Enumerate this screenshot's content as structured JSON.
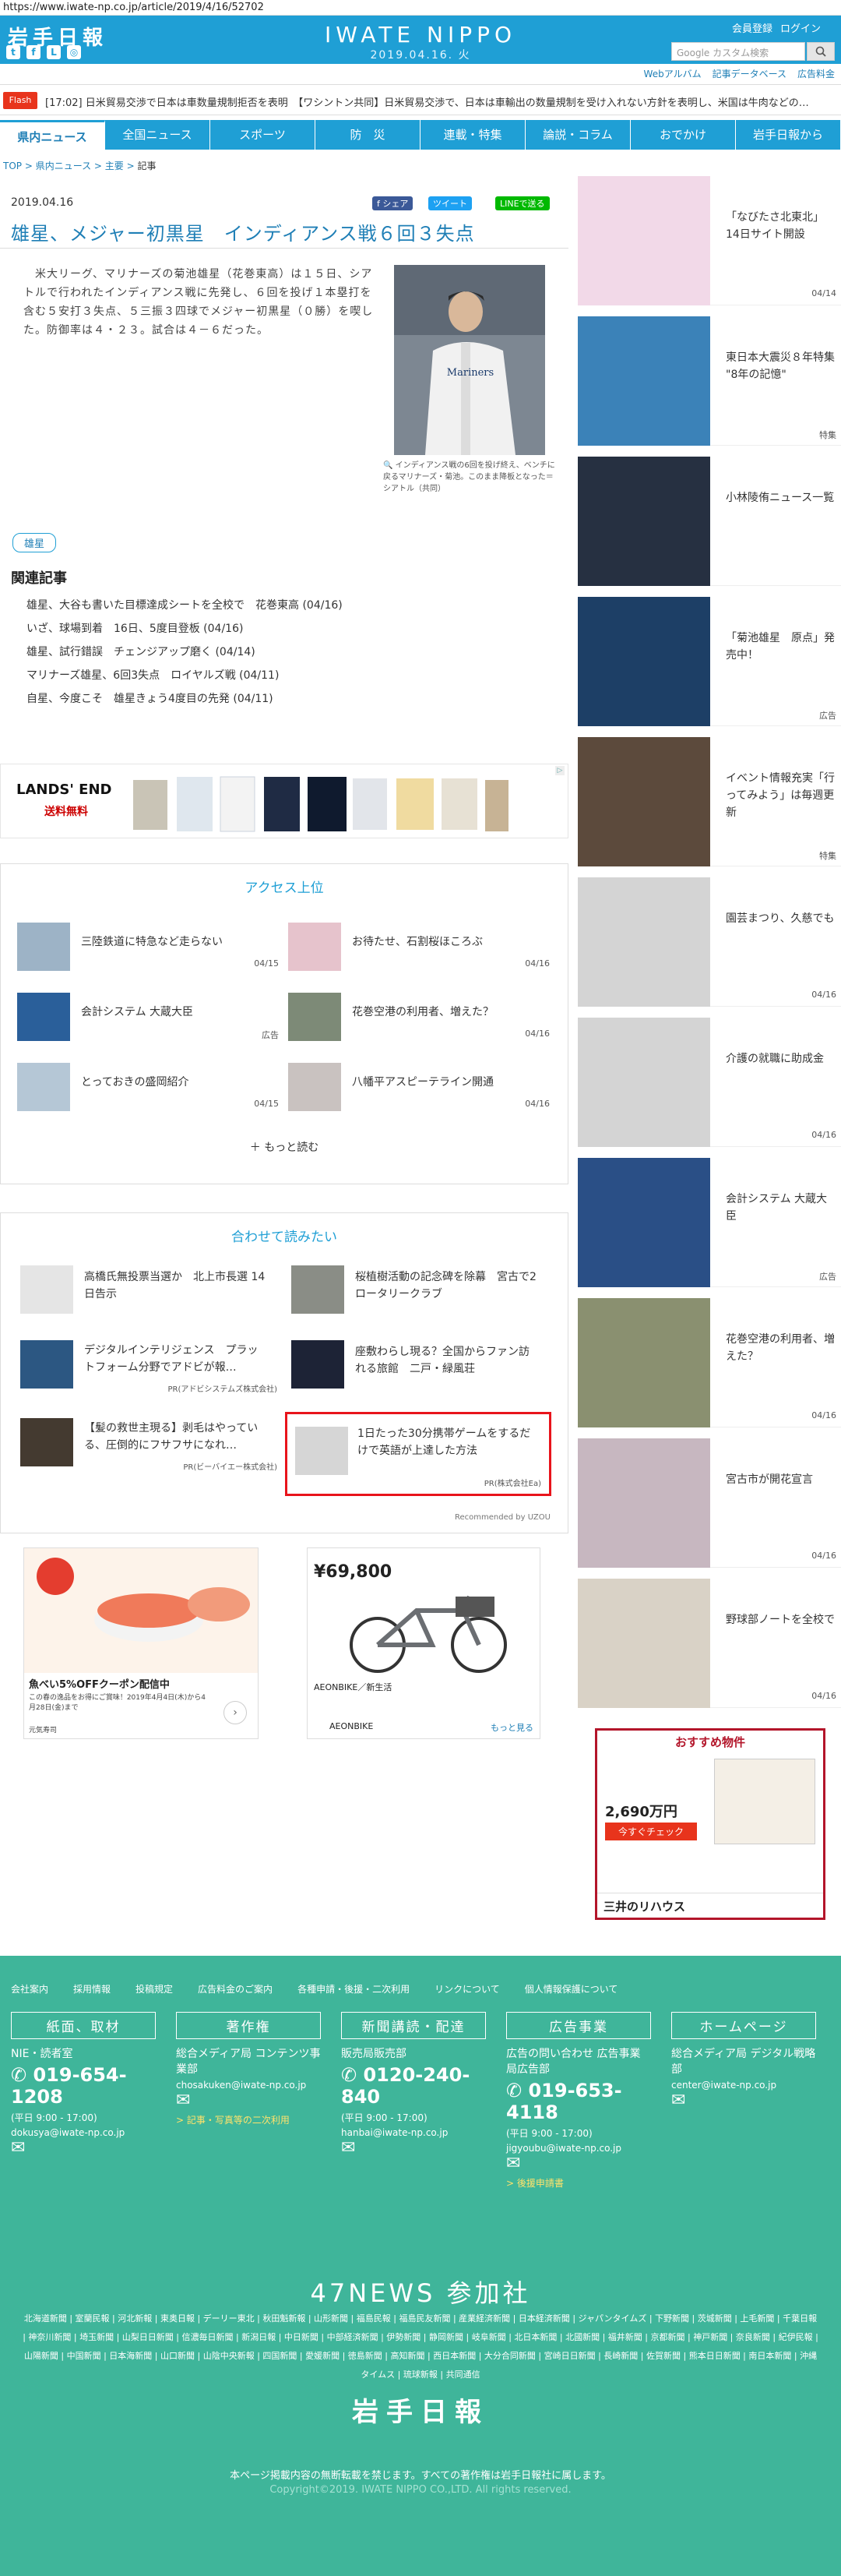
{
  "url": "https://www.iwate-np.co.jp/article/2019/4/16/52702",
  "header": {
    "logo": "岩手日報",
    "masthead": "IWATE NIPPO",
    "date": "2019.04.16. 火",
    "links": [
      "会員登録",
      "ログイン"
    ],
    "search_placeholder": "Google カスタム検索",
    "sublinks": [
      "Webアルバム",
      "記事データベース",
      "広告料金"
    ]
  },
  "flash": {
    "label": "Flash",
    "text": "[17:02] 日米貿易交渉で日本は車数量規制拒否を表明　【ワシントン共同】日米貿易交渉で、日本は車輸出の数量規制を受け入れない方針を表明し、米国は牛肉などの…"
  },
  "nav": [
    "県内ニュース",
    "全国ニュース",
    "スポーツ",
    "防　災",
    "連載・特集",
    "論説・コラム",
    "おでかけ",
    "岩手日報から"
  ],
  "breadcrumbs": [
    "TOP",
    "県内ニュース",
    "主要",
    "記事"
  ],
  "article": {
    "date": "2019.04.16",
    "share": [
      "f シェア",
      "ツイート",
      "LINEで送る"
    ],
    "title": "雄星、メジャー初黒星　インディアンス戦６回３失点",
    "body": "　米大リーグ、マリナーズの菊池雄星（花巻東高）は１５日、シアトルで行われたインディアンス戦に先発し、６回を投げ１本塁打を含む５安打３失点、５三振３四球でメジャー初黒星（０勝）を喫した。防御率は４・２３。試合は４－６だった。",
    "caption": "インディアンス戦の6回を投げ終え、ベンチに戻るマリナーズ・菊池。このまま降板となった＝シアトル（共同）",
    "tag": "雄星",
    "related_heading": "関連記事",
    "related": [
      "雄星、大谷も書いた目標達成シートを全校で　花巻東高 (04/16)",
      "いざ、球場到着　16日、5度目登板 (04/16)",
      "雄星、試行錯誤　チェンジアップ磨く (04/14)",
      "マリナーズ雄星、6回3失点　ロイヤルズ戦 (04/11)",
      "自星、今度こそ　雄星きょう4度目の先発 (04/11)"
    ]
  },
  "ad_top": {
    "brand": "LANDS' END",
    "sub": "送料無料"
  },
  "ranking": {
    "heading": "アクセス上位",
    "items": [
      {
        "title": "三陸鉄道に特急など走らない",
        "date": "04/15"
      },
      {
        "title": "お待たせ、石割桜ほころぶ",
        "date": "04/16"
      },
      {
        "title": "会計システム 大蔵大臣",
        "date": "広告"
      },
      {
        "title": "花巻空港の利用者、増えた？",
        "date": "04/16"
      },
      {
        "title": "とっておきの盛岡紹介",
        "date": "04/15"
      },
      {
        "title": "八幡平アスピーテライン開通",
        "date": "04/16"
      }
    ],
    "more": "もっと読む"
  },
  "recommend": {
    "heading": "合わせて読みたい",
    "items": [
      {
        "title": "高橋氏無投票当選か　北上市長選 14日告示",
        "src": ""
      },
      {
        "title": "桜植樹活動の記念碑を除幕　宮古で2ロータリークラブ",
        "src": ""
      },
      {
        "title": "デジタルインテリジェンス　プラットフォーム分野でアドビが報…",
        "src": "PR(アドビシステムズ株式会社)"
      },
      {
        "title": "座敷わらし現る？全国からファン訪れる旅館　二戸・緑風荘",
        "src": ""
      },
      {
        "title": "【髪の救世主現る】剥毛はやっている、圧倒的にフサフサになれ…",
        "src": "PR(ビーバイエー株式会社)"
      },
      {
        "title": "1日たった30分携帯ゲームをするだけで英語が上達した方法",
        "src": "PR(株式会社Ea)"
      }
    ],
    "powered": "Recommended by UZOU"
  },
  "ads_bottom": [
    {
      "title": "魚べい5%OFFクーポン配信中",
      "text": "この春の逸品をお得にご賞味！2019年4月4日(木)から4月28日(金)まで",
      "brand": "元気寿司"
    },
    {
      "title": "¥69,800",
      "text": "AEONBIKE／新生活",
      "brand": "AEONBIKE",
      "more": "もっと見る"
    }
  ],
  "sidebar": [
    {
      "title": "「なびたさ北東北」14日サイト開設",
      "date": "04/14"
    },
    {
      "title": "東日本大震災８年特集 \"8年の記憶\"",
      "date": "特集"
    },
    {
      "title": "小林陵侑ニュース一覧",
      "date": ""
    },
    {
      "title": "「菊池雄星　原点」発売中！",
      "date": "広告"
    },
    {
      "title": "イベント情報充実「行ってみよう」は毎週更新",
      "date": "特集"
    },
    {
      "title": "園芸まつり、久慈でも",
      "date": "04/16"
    },
    {
      "title": "介護の就職に助成金",
      "date": "04/16"
    },
    {
      "title": "会計システム 大蔵大臣",
      "date": "広告"
    },
    {
      "title": "花巻空港の利用者、増えた？",
      "date": "04/16"
    },
    {
      "title": "宮古市が開花宣言",
      "date": "04/16"
    },
    {
      "title": "野球部ノートを全校で",
      "date": "04/16"
    }
  ],
  "side_ad": {
    "head": "おすすめ物件",
    "price": "2,690万円",
    "btn": "今すぐチェック",
    "brand": "三井のリハウス"
  },
  "footer": {
    "links": [
      "会社案内",
      "採用情報",
      "投稿規定",
      "広告料金のご案内",
      "各種申請・後援・二次利用",
      "リンクについて",
      "個人情報保護について"
    ],
    "cols": [
      {
        "head": "紙面、取材",
        "sub": "NIE・読者室",
        "phone": "019-654-1208",
        "hours": "(平日 9:00 - 17:00)",
        "mail": "dokusya@iwate-np.co.jp"
      },
      {
        "head": "著作権",
        "sub": "総合メディア局 コンテンツ事業部",
        "phone": "",
        "hours": "",
        "mail": "chosakuken@iwate-np.co.jp",
        "link": "> 記事・写真等の二次利用"
      },
      {
        "head": "新聞講読・配達",
        "sub": "販売局販売部",
        "phone": "0120-240-840",
        "hours": "(平日 9:00 - 17:00)",
        "mail": "hanbai@iwate-np.co.jp"
      },
      {
        "head": "広告事業",
        "sub": "広告の問い合わせ 広告事業局広告部",
        "phone": "019-653-4118",
        "hours": "(平日 9:00 - 17:00)",
        "mail": "jigyoubu@iwate-np.co.jp",
        "link": "> 後援申請書"
      },
      {
        "head": "ホームページ",
        "sub": "総合メディア局 デジタル戦略部",
        "phone": "",
        "hours": "",
        "mail": "center@iwate-np.co.jp"
      }
    ],
    "news47": "47NEWS 参加社",
    "papers": "北海道新聞 | 室蘭民報 | 河北新報 | 東奥日報 | デーリー東北 | 秋田魁新報 | 山形新聞 | 福島民報 | 福島民友新聞 | 産業経済新聞 | 日本経済新聞 | ジャパンタイムズ | 下野新聞 | 茨城新聞 | 上毛新聞 | 千葉日報 | 神奈川新聞 | 埼玉新聞 | 山梨日日新聞 | 信濃毎日新聞 | 新潟日報 | 中日新聞 | 中部経済新聞 | 伊勢新聞 | 静岡新聞 | 岐阜新聞 | 北日本新聞 | 北國新聞 | 福井新聞 | 京都新聞 | 神戸新聞 | 奈良新聞 | 紀伊民報 | 山陽新聞 | 中国新聞 | 日本海新聞 | 山口新聞 | 山陰中央新報 | 四国新聞 | 愛媛新聞 | 徳島新聞 | 高知新聞 | 西日本新聞 | 大分合同新聞 | 宮崎日日新聞 | 長崎新聞 | 佐賀新聞 | 熊本日日新聞 | 南日本新聞 | 沖縄タイムス | 琉球新報 | 共同通信",
    "logo": "岩手日報",
    "note": "本ページ掲載内容の無断転載を禁じます。すべての著作権は岩手日報社に属します。",
    "copy": "Copyright©2019. IWATE NIPPO CO.,LTD. All rights reserved."
  }
}
